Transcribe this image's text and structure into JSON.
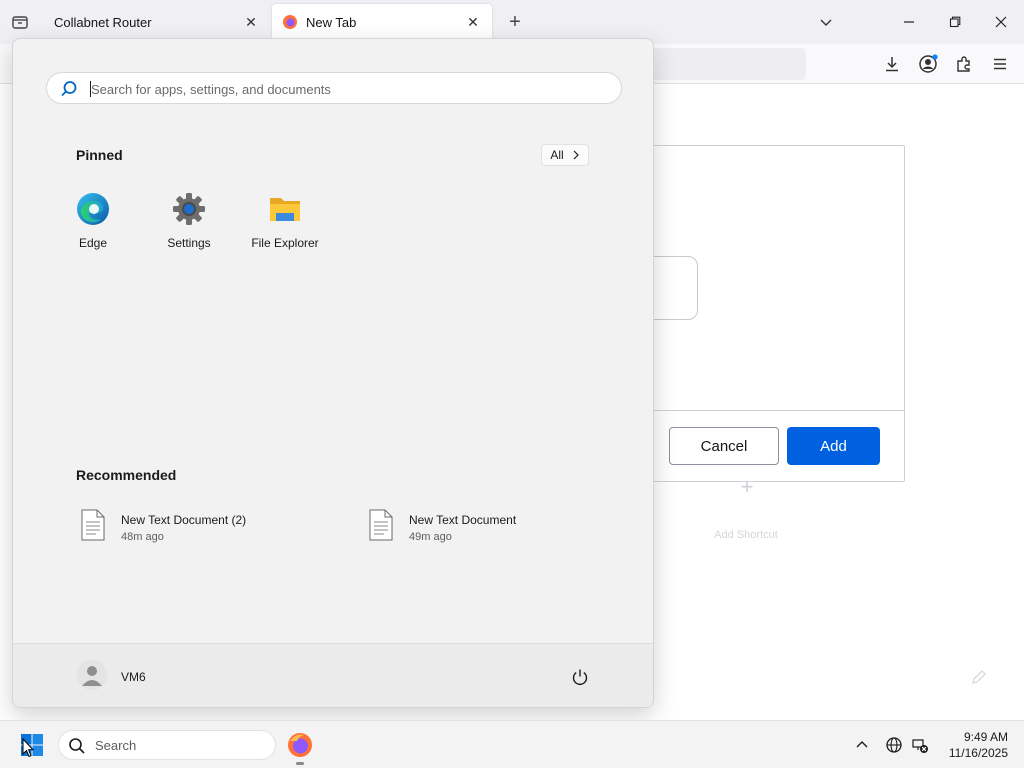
{
  "browser": {
    "tabs": [
      {
        "title": "Collabnet Router",
        "active": false
      },
      {
        "title": "New Tab",
        "active": true
      }
    ]
  },
  "page": {
    "dialog": {
      "cancel_label": "Cancel",
      "add_label": "Add"
    },
    "shortcut_label": "Add Shortcut"
  },
  "start_menu": {
    "search_placeholder": "Search for apps, settings, and documents",
    "pinned_title": "Pinned",
    "all_label": "All",
    "pinned_apps": [
      {
        "label": "Edge",
        "icon": "edge-icon"
      },
      {
        "label": "Settings",
        "icon": "settings-gear-icon"
      },
      {
        "label": "File Explorer",
        "icon": "folder-icon"
      }
    ],
    "recommended_title": "Recommended",
    "recommended": [
      {
        "name": "New Text Document (2)",
        "time": "48m ago"
      },
      {
        "name": "New Text Document",
        "time": "49m ago"
      }
    ],
    "user_name": "VM6"
  },
  "taskbar": {
    "search_label": "Search",
    "time": "9:49 AM",
    "date": "11/16/2025"
  },
  "colors": {
    "accent": "#0067c0",
    "add_button": "#0061e0"
  }
}
